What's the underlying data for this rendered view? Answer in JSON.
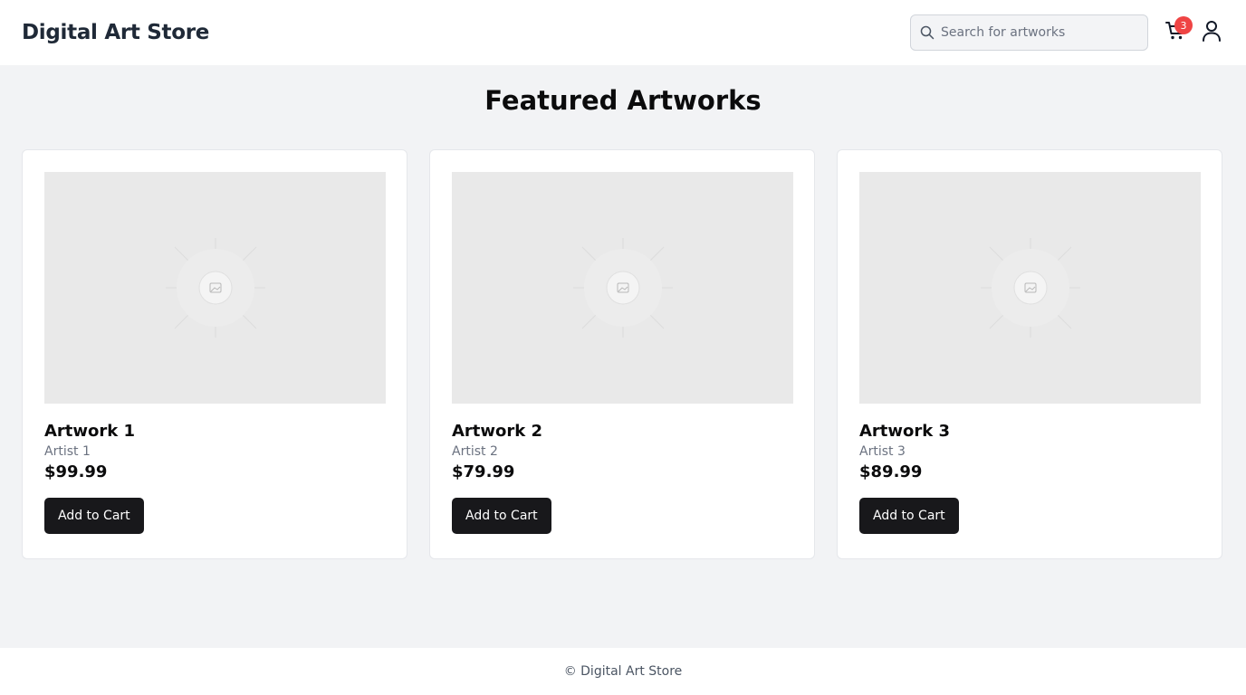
{
  "header": {
    "brand": "Digital Art Store",
    "search": {
      "placeholder": "Search for artworks",
      "value": "",
      "icon": "search-icon"
    },
    "cart": {
      "icon": "cart-icon",
      "count": "3",
      "badge_color": "#ef4444"
    },
    "user": {
      "icon": "user-icon"
    }
  },
  "main": {
    "title": "Featured Artworks",
    "artworks": [
      {
        "title": "Artwork 1",
        "artist": "Artist 1",
        "price": "$99.99",
        "button": "Add to Cart"
      },
      {
        "title": "Artwork 2",
        "artist": "Artist 2",
        "price": "$79.99",
        "button": "Add to Cart"
      },
      {
        "title": "Artwork 3",
        "artist": "Artist 3",
        "price": "$89.99",
        "button": "Add to Cart"
      }
    ]
  },
  "footer": {
    "text": "© Digital Art Store"
  },
  "colors": {
    "button": "#18181b",
    "background": "#f2f3f5",
    "badge": "#ef4444"
  }
}
